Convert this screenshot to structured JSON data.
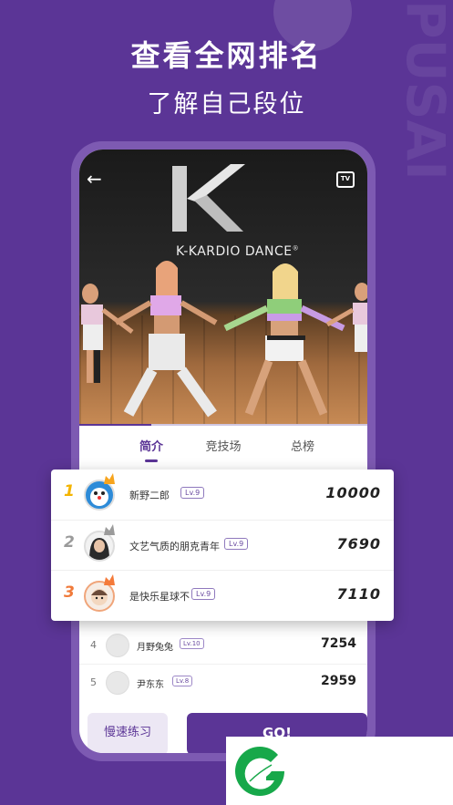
{
  "page": {
    "title": "查看全网排名",
    "subtitle": "了解自己段位",
    "watermark": "PUSAI"
  },
  "video": {
    "logo_text": "K-KARDIO DANCE",
    "logo_mark": "®",
    "tv_label": "TV",
    "back_icon": "arrow-left-icon",
    "progress": 0.25
  },
  "tabs": [
    {
      "label": "简介",
      "active": true
    },
    {
      "label": "竞技场",
      "active": false
    },
    {
      "label": "总榜",
      "active": false
    }
  ],
  "podium": [
    {
      "rank": "1",
      "name": "新野二郎",
      "level": "Lv.9",
      "score": "10000",
      "rank_color": "#f4b400",
      "crown_color": "#f7a41d",
      "avatar_color": "#2d8bd8"
    },
    {
      "rank": "2",
      "name": "文艺气质的朋克青年",
      "level": "Lv.9",
      "score": "7690",
      "rank_color": "#9a9a9a",
      "crown_color": "#9b9b9b",
      "avatar_color": "#3a3a3a"
    },
    {
      "rank": "3",
      "name": "是快乐星球不",
      "level": "Lv.9",
      "score": "7110",
      "rank_color": "#f07a3a",
      "crown_color": "#f47a3a",
      "avatar_color": "#d9a98b"
    }
  ],
  "list": [
    {
      "rank": "4",
      "name": "月野兔兔",
      "level": "Lv.10",
      "score": "7254"
    },
    {
      "rank": "5",
      "name": "尹东东",
      "level": "Lv.8",
      "score": "2959"
    }
  ],
  "buttons": {
    "slow_practice": "慢速练习",
    "go": "GO!"
  },
  "colors": {
    "background": "#5b3596",
    "accent": "#5b3596",
    "logo_green": "#17a84a"
  }
}
